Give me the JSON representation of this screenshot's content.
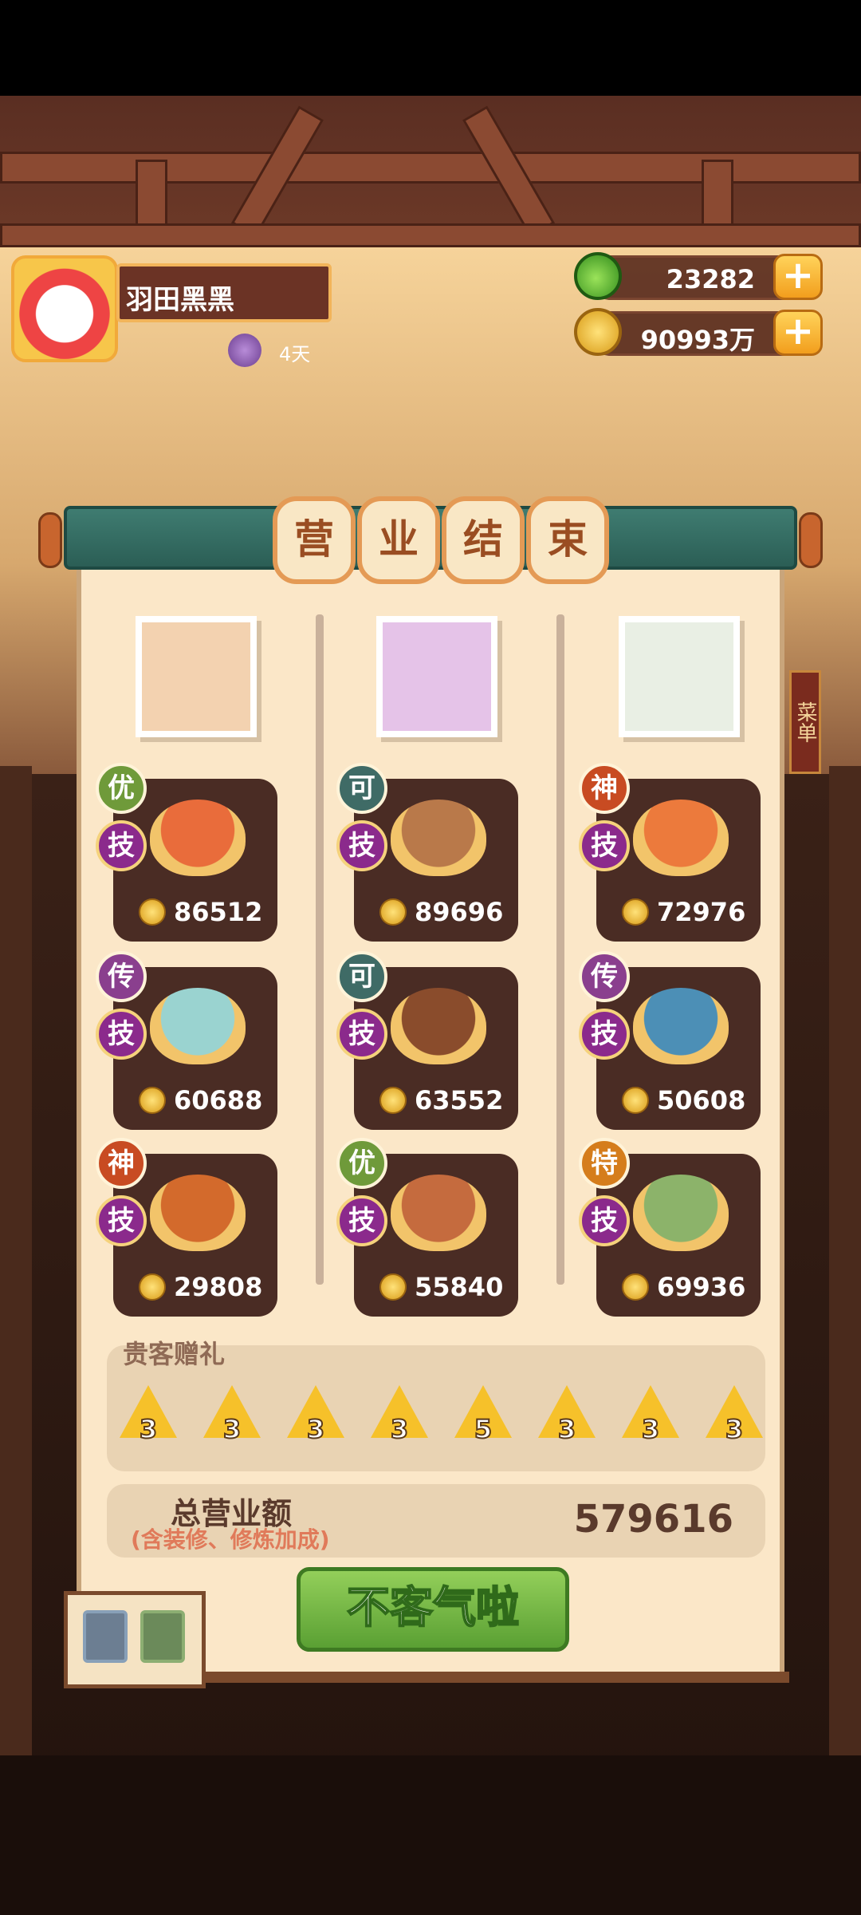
{
  "player": {
    "name": "羽田黑黑",
    "streak_days": "4天"
  },
  "currencies": {
    "jade": "23282",
    "coins": "90993万"
  },
  "side_tag": "菜单",
  "title_chars": [
    "营",
    "业",
    "结",
    "束"
  ],
  "chefs": [
    {
      "portrait_color": "#f3d2b0",
      "dishes": [
        {
          "rank": "优",
          "rank_color": "#6f9a3a",
          "skill": "技",
          "amount": "86512",
          "plate_color": "#e96c3b"
        },
        {
          "rank": "传",
          "rank_color": "#8a3f8e",
          "skill": "技",
          "amount": "60688",
          "plate_color": "#9ad3d0"
        },
        {
          "rank": "神",
          "rank_color": "#c84b22",
          "skill": "技",
          "amount": "29808",
          "plate_color": "#d36a2c"
        }
      ]
    },
    {
      "portrait_color": "#e5c3e8",
      "dishes": [
        {
          "rank": "可",
          "rank_color": "#3f6b66",
          "skill": "技",
          "amount": "89696",
          "plate_color": "#b9794a"
        },
        {
          "rank": "可",
          "rank_color": "#3f6b66",
          "skill": "技",
          "amount": "63552",
          "plate_color": "#8a4c2c"
        },
        {
          "rank": "优",
          "rank_color": "#6f9a3a",
          "skill": "技",
          "amount": "55840",
          "plate_color": "#c56b3e"
        }
      ]
    },
    {
      "portrait_color": "#e9efe4",
      "dishes": [
        {
          "rank": "神",
          "rank_color": "#c84b22",
          "skill": "技",
          "amount": "72976",
          "plate_color": "#ec7a3c"
        },
        {
          "rank": "传",
          "rank_color": "#8a3f8e",
          "skill": "技",
          "amount": "50608",
          "plate_color": "#4c8fb6"
        },
        {
          "rank": "特",
          "rank_color": "#d57d1c",
          "skill": "技",
          "amount": "69936",
          "plate_color": "#8cb36a"
        }
      ]
    }
  ],
  "vip_gifts": {
    "title": "贵客赠礼",
    "counts": [
      "3",
      "3",
      "3",
      "3",
      "5",
      "3",
      "3",
      "3"
    ]
  },
  "total": {
    "label": "总营业额",
    "sub": "(含装修、修炼加成)",
    "value": "579616"
  },
  "confirm_button": "不客气啦"
}
